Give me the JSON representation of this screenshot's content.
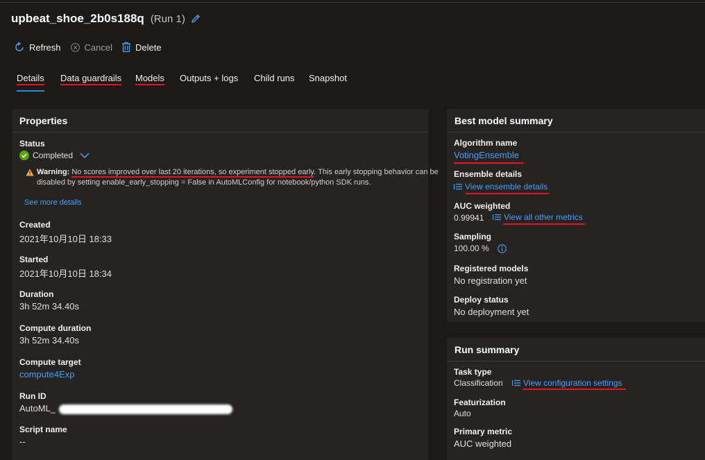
{
  "header": {
    "run_name": "upbeat_shoe_2b0s188q",
    "run_label": "(Run 1)"
  },
  "toolbar": {
    "refresh": "Refresh",
    "cancel": "Cancel",
    "delete": "Delete"
  },
  "tabs": [
    "Details",
    "Data guardrails",
    "Models",
    "Outputs + logs",
    "Child runs",
    "Snapshot"
  ],
  "properties": {
    "title": "Properties",
    "status_label": "Status",
    "status_value": "Completed",
    "warning_prefix": "Warning:",
    "warning_highlight": "No scores improved over last 20 iterations, so experiment stopped early",
    "warning_rest": ". This early stopping behavior can be disabled by setting enable_early_stopping = False in AutoMLConfig for notebook/python SDK runs.",
    "see_more": "See more details",
    "created_label": "Created",
    "created_value": "2021年10月10日 18:33",
    "started_label": "Started",
    "started_value": "2021年10月10日 18:34",
    "duration_label": "Duration",
    "duration_value": "3h 52m 34.40s",
    "compute_duration_label": "Compute duration",
    "compute_duration_value": "3h 52m 34.40s",
    "compute_target_label": "Compute target",
    "compute_target_value": "compute4Exp",
    "run_id_label": "Run ID",
    "run_id_prefix": "AutoML_",
    "script_name_label": "Script name",
    "script_name_value": "--"
  },
  "best_model": {
    "title": "Best model summary",
    "algorithm_label": "Algorithm name",
    "algorithm_value": "VotingEnsemble",
    "ensemble_label": "Ensemble details",
    "ensemble_link": "View ensemble details",
    "auc_label": "AUC weighted",
    "auc_value": "0.99941",
    "auc_link": "View all other metrics",
    "sampling_label": "Sampling",
    "sampling_value": "100.00 %",
    "registered_label": "Registered models",
    "registered_value": "No registration yet",
    "deploy_label": "Deploy status",
    "deploy_value": "No deployment yet"
  },
  "run_summary": {
    "title": "Run summary",
    "task_label": "Task type",
    "task_value": "Classification",
    "config_link": "View configuration settings",
    "featurization_label": "Featurization",
    "featurization_value": "Auto",
    "primary_metric_label": "Primary metric",
    "primary_metric_value": "AUC weighted"
  },
  "colors": {
    "accent": "#479ef5",
    "annotation": "#e81123",
    "success": "#57a300",
    "warning": "#ffaa44"
  }
}
